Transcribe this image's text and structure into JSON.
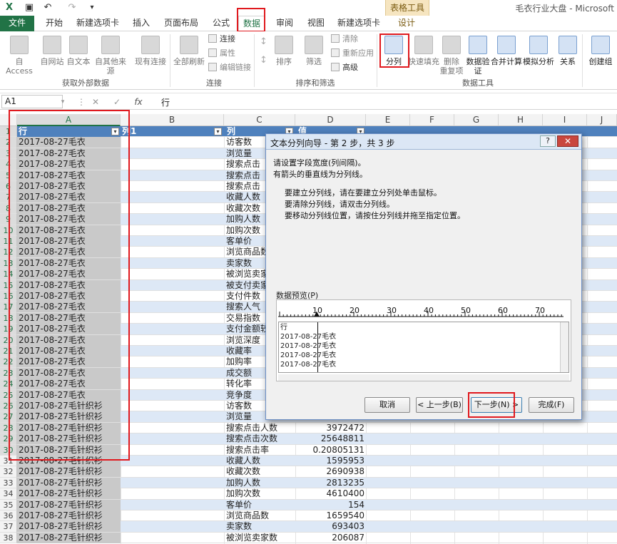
{
  "window": {
    "title": "毛衣行业大盘 - Microsoft",
    "context_tab_group": "表格工具"
  },
  "tabs": [
    "文件",
    "开始",
    "新建选项卡",
    "插入",
    "页面布局",
    "公式",
    "数据",
    "审阅",
    "视图",
    "新建选项卡",
    "设计"
  ],
  "ribbon": {
    "get_external": {
      "from_access": "自 Access",
      "from_web": "自网站",
      "from_text": "自文本",
      "from_other": "自其他来源",
      "existing": "现有连接",
      "group": "获取外部数据"
    },
    "connections": {
      "refresh_all": "全部刷新",
      "connect": "连接",
      "properties": "属性",
      "edit_links": "编辑链接",
      "group": "连接"
    },
    "sort_filter": {
      "sort": "排序",
      "filter": "筛选",
      "clear": "清除",
      "reapply": "重新应用",
      "advanced": "高级",
      "group": "排序和筛选"
    },
    "data_tools": {
      "text_to_columns": "分列",
      "flash_fill": "快速填充",
      "remove_dup": "删除\n重复项",
      "validation": "数据验\n证",
      "consolidate": "合并计算",
      "what_if": "模拟分析",
      "relationships": "关系",
      "create_group": "创建组",
      "group": "数据工具"
    }
  },
  "formula_bar": {
    "name_box": "A1",
    "fx_label": "fx",
    "content": "行"
  },
  "columns": [
    "A",
    "B",
    "C",
    "D",
    "E",
    "F",
    "G",
    "H",
    "I",
    "J"
  ],
  "table": {
    "header": {
      "a": "行",
      "b": "列1",
      "c": "列",
      "d": "值"
    },
    "rows": [
      {
        "n": "2",
        "a": "2017-08-27毛衣",
        "c": "访客数",
        "d": ""
      },
      {
        "n": "3",
        "a": "2017-08-27毛衣",
        "c": "浏览量",
        "d": ""
      },
      {
        "n": "4",
        "a": "2017-08-27毛衣",
        "c": "搜索点击",
        "d": ""
      },
      {
        "n": "5",
        "a": "2017-08-27毛衣",
        "c": "搜索点击",
        "d": ""
      },
      {
        "n": "6",
        "a": "2017-08-27毛衣",
        "c": "搜索点击",
        "d": ""
      },
      {
        "n": "7",
        "a": "2017-08-27毛衣",
        "c": "收藏人数",
        "d": ""
      },
      {
        "n": "8",
        "a": "2017-08-27毛衣",
        "c": "收藏次数",
        "d": ""
      },
      {
        "n": "9",
        "a": "2017-08-27毛衣",
        "c": "加购人数",
        "d": ""
      },
      {
        "n": "10",
        "a": "2017-08-27毛衣",
        "c": "加购次数",
        "d": ""
      },
      {
        "n": "11",
        "a": "2017-08-27毛衣",
        "c": "客单价",
        "d": ""
      },
      {
        "n": "12",
        "a": "2017-08-27毛衣",
        "c": "浏览商品数",
        "d": ""
      },
      {
        "n": "13",
        "a": "2017-08-27毛衣",
        "c": "卖家数",
        "d": ""
      },
      {
        "n": "14",
        "a": "2017-08-27毛衣",
        "c": "被浏览卖家",
        "d": ""
      },
      {
        "n": "15",
        "a": "2017-08-27毛衣",
        "c": "被支付卖家",
        "d": ""
      },
      {
        "n": "16",
        "a": "2017-08-27毛衣",
        "c": "支付件数",
        "d": ""
      },
      {
        "n": "17",
        "a": "2017-08-27毛衣",
        "c": "搜索人气",
        "d": ""
      },
      {
        "n": "18",
        "a": "2017-08-27毛衣",
        "c": "交易指数",
        "d": ""
      },
      {
        "n": "19",
        "a": "2017-08-27毛衣",
        "c": "支付金额较",
        "d": ""
      },
      {
        "n": "20",
        "a": "2017-08-27毛衣",
        "c": "浏览深度",
        "d": ""
      },
      {
        "n": "21",
        "a": "2017-08-27毛衣",
        "c": "收藏率",
        "d": ""
      },
      {
        "n": "22",
        "a": "2017-08-27毛衣",
        "c": "加购率",
        "d": ""
      },
      {
        "n": "23",
        "a": "2017-08-27毛衣",
        "c": "成交额",
        "d": ""
      },
      {
        "n": "24",
        "a": "2017-08-27毛衣",
        "c": "转化率",
        "d": ""
      },
      {
        "n": "25",
        "a": "2017-08-27毛衣",
        "c": "竞争度",
        "d": ""
      },
      {
        "n": "26",
        "a": "2017-08-27毛针织衫",
        "c": "访客数",
        "d": ""
      },
      {
        "n": "27",
        "a": "2017-08-27毛针织衫",
        "c": "浏览量",
        "d": ""
      },
      {
        "n": "28",
        "a": "2017-08-27毛针织衫",
        "c": "搜索点击人数",
        "d": "3972472"
      },
      {
        "n": "29",
        "a": "2017-08-27毛针织衫",
        "c": "搜索点击次数",
        "d": "25648811"
      },
      {
        "n": "30",
        "a": "2017-08-27毛针织衫",
        "c": "搜索点击率",
        "d": "0.20805131"
      },
      {
        "n": "31",
        "a": "2017-08-27毛针织衫",
        "c": "收藏人数",
        "d": "1595953"
      },
      {
        "n": "32",
        "a": "2017-08-27毛针织衫",
        "c": "收藏次数",
        "d": "2690938"
      },
      {
        "n": "33",
        "a": "2017-08-27毛针织衫",
        "c": "加购人数",
        "d": "2813235"
      },
      {
        "n": "34",
        "a": "2017-08-27毛针织衫",
        "c": "加购次数",
        "d": "4610400"
      },
      {
        "n": "35",
        "a": "2017-08-27毛针织衫",
        "c": "客单价",
        "d": "154"
      },
      {
        "n": "36",
        "a": "2017-08-27毛针织衫",
        "c": "浏览商品数",
        "d": "1659540"
      },
      {
        "n": "37",
        "a": "2017-08-27毛针织衫",
        "c": "卖家数",
        "d": "693403"
      },
      {
        "n": "38",
        "a": "2017-08-27毛针织衫",
        "c": "被浏览卖家数",
        "d": "206087"
      }
    ]
  },
  "dialog": {
    "title": "文本分列向导 - 第 2 步，共 3 步",
    "help": "?",
    "close": "✕",
    "line1": "请设置字段宽度(列间隔)。",
    "line2": "有箭头的垂直线为分列线。",
    "inst1": "要建立分列线，请在要建立分列处单击鼠标。",
    "inst2": "要清除分列线，请双击分列线。",
    "inst3": "要移动分列线位置，请按住分列线并拖至指定位置。",
    "preview_label": "数据预览(P)",
    "ruler": [
      "10",
      "20",
      "30",
      "40",
      "50",
      "60",
      "70"
    ],
    "preview_lines": [
      "行",
      "2017-08-27毛衣",
      "2017-08-27毛衣",
      "2017-08-27毛衣",
      "2017-08-27毛衣"
    ],
    "buttons": {
      "cancel": "取消",
      "back": "< 上一步(B)",
      "next": "下一步(N) >",
      "finish": "完成(F)"
    }
  }
}
